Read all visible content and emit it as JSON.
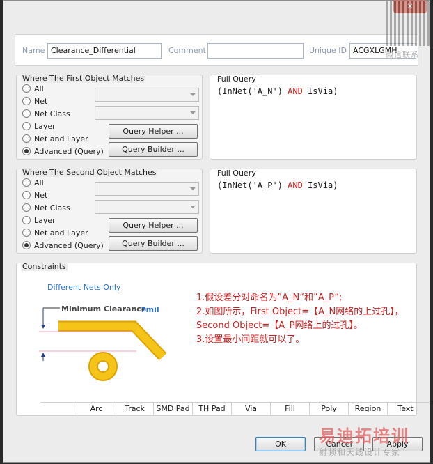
{
  "window": {
    "close_label": "✕"
  },
  "meta": {
    "name_label": "Name",
    "name_value": "Clearance_Differential",
    "comment_label": "Comment",
    "comment_value": "",
    "uid_label": "Unique ID",
    "uid_value": "ACGXLGMH"
  },
  "first": {
    "title": "Where The First Object Matches",
    "options": [
      "All",
      "Net",
      "Net Class",
      "Layer",
      "Net and Layer",
      "Advanced (Query)"
    ],
    "selected": "Advanced (Query)",
    "helper_btn": "Query Helper ...",
    "builder_btn": "Query Builder ...",
    "full_query_title": "Full Query",
    "query_a": "(InNet('A_N') ",
    "query_kw": "AND",
    "query_b": " IsVia)"
  },
  "second": {
    "title": "Where The Second Object Matches",
    "options": [
      "All",
      "Net",
      "Net Class",
      "Layer",
      "Net and Layer",
      "Advanced (Query)"
    ],
    "selected": "Advanced (Query)",
    "helper_btn": "Query Helper ...",
    "builder_btn": "Query Builder ...",
    "full_query_title": "Full Query",
    "query_a": "(InNet('A_P') ",
    "query_kw": "AND",
    "query_b": " IsVia)"
  },
  "constraints": {
    "title": "Constraints",
    "diff_nets": "Different Nets Only",
    "min_clearance": "Minimum Clearance",
    "clearance_value": "7mil",
    "tabs": [
      "Arc",
      "Track",
      "SMD Pad",
      "TH Pad",
      "Via",
      "Fill",
      "Poly",
      "Region",
      "Text"
    ],
    "annotation": [
      "1.假设差分对命名为”A_N“和”A_P“;",
      "2.如图所示，First Object=【A_N网络的上过孔】，Second Object=【A_P网络上的过孔】。",
      "3.设置最小间距就可以了。"
    ]
  },
  "footer": {
    "ok": "OK",
    "cancel": "Cancel",
    "apply": "Apply"
  },
  "watermarks": {
    "wechat": "微信联系",
    "brand": "易迪拓培训",
    "sub": "射频和天线设计专家"
  },
  "colors": {
    "accent": "#d01f1f",
    "label": "#8c9ab5",
    "track": "#f2b800"
  }
}
